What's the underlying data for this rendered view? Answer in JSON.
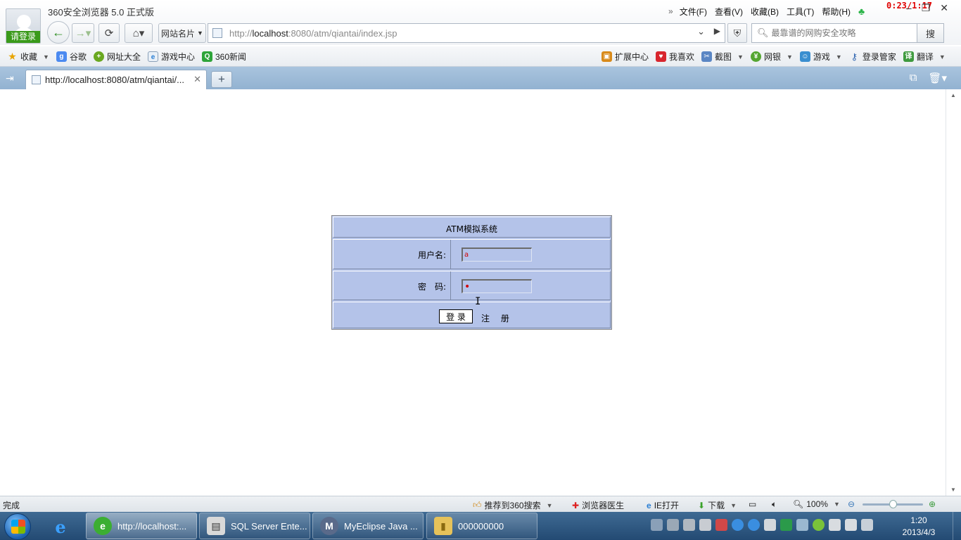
{
  "browser": {
    "title": "360安全浏览器 5.0 正式版",
    "login_badge": "请登录",
    "timer": "0:23/1:17",
    "menu": [
      "文件(F)",
      "查看(V)",
      "收藏(B)",
      "工具(T)",
      "帮助(H)"
    ],
    "site_card": "网站名片",
    "url_prefix": "http://",
    "url_host": "localhost",
    "url_rest": ":8080/atm/qiantai/index.jsp",
    "search_placeholder": "最靠谱的网购安全攻略",
    "search_button": "搜"
  },
  "bookmarks": {
    "left": [
      "收藏",
      "谷歌",
      "网址大全",
      "游戏中心",
      "360新闻"
    ],
    "right": [
      "扩展中心",
      "我喜欢",
      "截图",
      "网银",
      "游戏",
      "登录管家",
      "翻译"
    ]
  },
  "tab": {
    "title": "http://localhost:8080/atm/qiantai/..."
  },
  "login": {
    "system_title": "ATM模拟系统",
    "username_label": "用户名:",
    "username_value": "a",
    "password_label": "密　码:",
    "password_value": "•",
    "login_button": "登 录",
    "register_link": "注 册"
  },
  "statusbar": {
    "status": "完成",
    "recommend": "推荐到360搜索",
    "doctor": "浏览器医生",
    "ie_open": "IE打开",
    "download": "下载",
    "zoom": "100%"
  },
  "taskbar": {
    "tasks": [
      "http://localhost:...",
      "SQL Server Ente...",
      "MyEclipse Java ...",
      "000000000"
    ],
    "time": "1:20",
    "date": "2013/4/3"
  },
  "colors": {
    "login_bg": "#b4c3e9",
    "tab_bar": "#a9c4de",
    "taskbar": "#2b5480"
  }
}
